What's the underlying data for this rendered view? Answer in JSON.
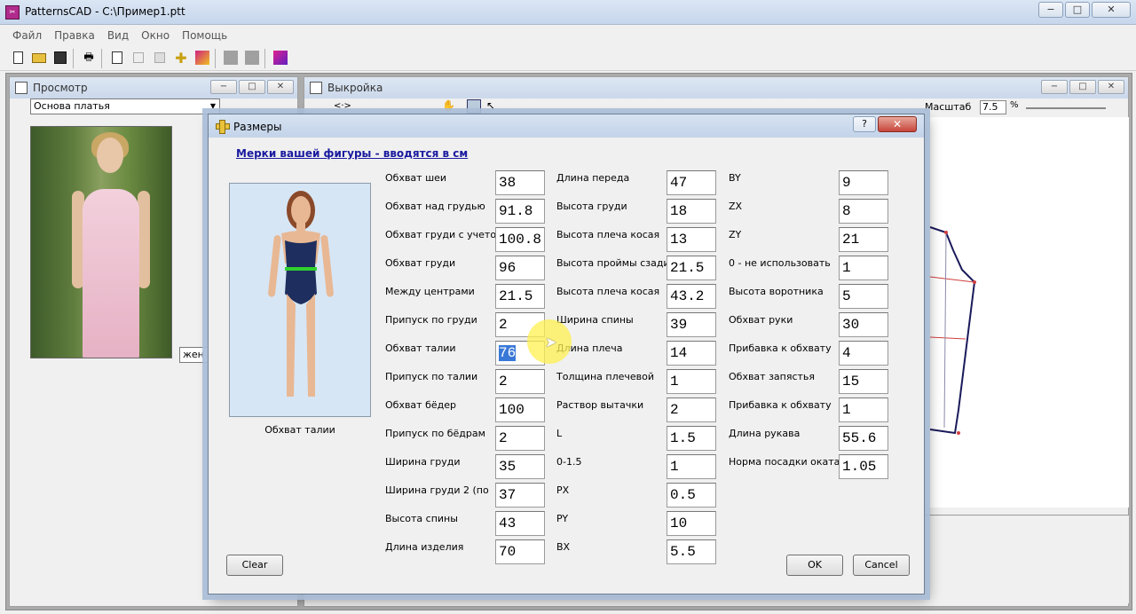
{
  "app": {
    "title": "PatternsCAD - C:\\Пример1.ptt",
    "icon": "pattern-app-icon"
  },
  "window_buttons": [
    "−",
    "□",
    "✕"
  ],
  "menu": [
    "Файл",
    "Правка",
    "Вид",
    "Окно",
    "Помощь"
  ],
  "preview": {
    "title": "Просмотр",
    "combo_value": "Основа платья",
    "gender_value": "жен"
  },
  "pattern": {
    "title": "Выкройка",
    "scale_label": "Масштаб",
    "scale_value": "7.5",
    "scale_unit": "%",
    "nav_label": "<·>"
  },
  "dialog": {
    "title": "Размеры",
    "help": "?",
    "heading": "Мерки вашей фигуры - вводятся в см",
    "figure_caption": "Обхват талии",
    "clear_label": "Clear",
    "ok_label": "OK",
    "cancel_label": "Cancel",
    "columns": [
      [
        {
          "label": "Обхват шеи",
          "value": "38"
        },
        {
          "label": "Обхват над грудью",
          "value": "91.8"
        },
        {
          "label": "Обхват груди с учетом",
          "value": "100.8"
        },
        {
          "label": "Обхват груди",
          "value": "96"
        },
        {
          "label": "Между центрами",
          "value": "21.5"
        },
        {
          "label": "Припуск по груди",
          "value": "2"
        },
        {
          "label": "Обхват талии",
          "value": "76",
          "selected": true
        },
        {
          "label": "Припуск по талии",
          "value": "2"
        },
        {
          "label": "Обхват бёдер",
          "value": "100"
        },
        {
          "label": "Припуск по бёдрам",
          "value": "2"
        },
        {
          "label": "Ширина груди",
          "value": "35"
        },
        {
          "label": "Ширина груди 2 (по",
          "value": "37"
        },
        {
          "label": "Высота спины",
          "value": "43"
        },
        {
          "label": "Длина изделия",
          "value": "70"
        }
      ],
      [
        {
          "label": "Длина переда",
          "value": "47"
        },
        {
          "label": "Высота груди",
          "value": "18"
        },
        {
          "label": "Высота плеча косая",
          "value": "13"
        },
        {
          "label": "Высота проймы сзади",
          "value": "21.5"
        },
        {
          "label": "Высота плеча косая",
          "value": "43.2"
        },
        {
          "label": "Ширина спины",
          "value": "39"
        },
        {
          "label": "Длина плеча",
          "value": "14"
        },
        {
          "label": "Толщина плечевой",
          "value": "1"
        },
        {
          "label": "Раствор вытачки",
          "value": "2"
        },
        {
          "label": "L",
          "value": "1.5"
        },
        {
          "label": "0-1.5",
          "value": "1"
        },
        {
          "label": "PX",
          "value": "0.5"
        },
        {
          "label": "PY",
          "value": "10"
        },
        {
          "label": "BX",
          "value": "5.5"
        }
      ],
      [
        {
          "label": "BY",
          "value": "9"
        },
        {
          "label": "ZX",
          "value": "8"
        },
        {
          "label": "ZY",
          "value": "21"
        },
        {
          "label": "0 - не использовать",
          "value": "1"
        },
        {
          "label": "Высота воротника",
          "value": "5"
        },
        {
          "label": "Обхват руки",
          "value": "30"
        },
        {
          "label": "Прибавка к обхвату",
          "value": "4"
        },
        {
          "label": "Обхват запястья",
          "value": "15"
        },
        {
          "label": "Прибавка к обхвату",
          "value": "1"
        },
        {
          "label": "Длина рукава",
          "value": "55.6"
        },
        {
          "label": "Норма посадки оката",
          "value": "1.05"
        }
      ]
    ]
  },
  "colors": {
    "heading": "#1a1aa0",
    "selection": "#3a78d8",
    "waist_marker": "#2fd22f",
    "close_button": "#c6453a"
  }
}
